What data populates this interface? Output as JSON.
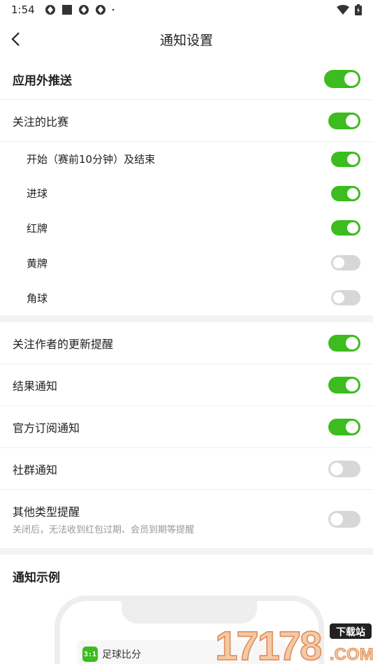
{
  "status_bar": {
    "time": "1:54",
    "icons_left": [
      "sync-icon",
      "square-icon",
      "sync-icon",
      "sync-icon",
      "dot-icon"
    ],
    "icons_right": [
      "wifi-icon",
      "battery-icon"
    ]
  },
  "nav": {
    "title": "通知设置",
    "back_icon": "chevron-left-icon"
  },
  "settings": {
    "push_outside": {
      "label": "应用外推送",
      "on": true
    },
    "followed_matches": {
      "label": "关注的比赛",
      "on": true
    },
    "match_start_end": {
      "label": "开始（赛前10分钟）及结束",
      "on": true
    },
    "goal": {
      "label": "进球",
      "on": true
    },
    "red_card": {
      "label": "红牌",
      "on": true
    },
    "yellow_card": {
      "label": "黄牌",
      "on": false
    },
    "corner": {
      "label": "角球",
      "on": false
    },
    "author_updates": {
      "label": "关注作者的更新提醒",
      "on": true
    },
    "result_notice": {
      "label": "结果通知",
      "on": true
    },
    "official_subscription": {
      "label": "官方订阅通知",
      "on": true
    },
    "community_notice": {
      "label": "社群通知",
      "on": false
    },
    "other_reminders": {
      "label": "其他类型提醒",
      "desc": "关闭后，无法收到红包过期、会员到期等提醒",
      "on": false
    }
  },
  "example": {
    "title": "通知示例",
    "app_icon_text": "3:1",
    "app_name": "足球比分"
  },
  "watermark": {
    "number": "17178",
    "badge": "下载站",
    "domain": ".COM"
  },
  "colors": {
    "accent": "#3cbc1e",
    "toggle_off": "#d7d7d7",
    "divider": "#efefef",
    "section_gap": "#f3f3f3"
  }
}
